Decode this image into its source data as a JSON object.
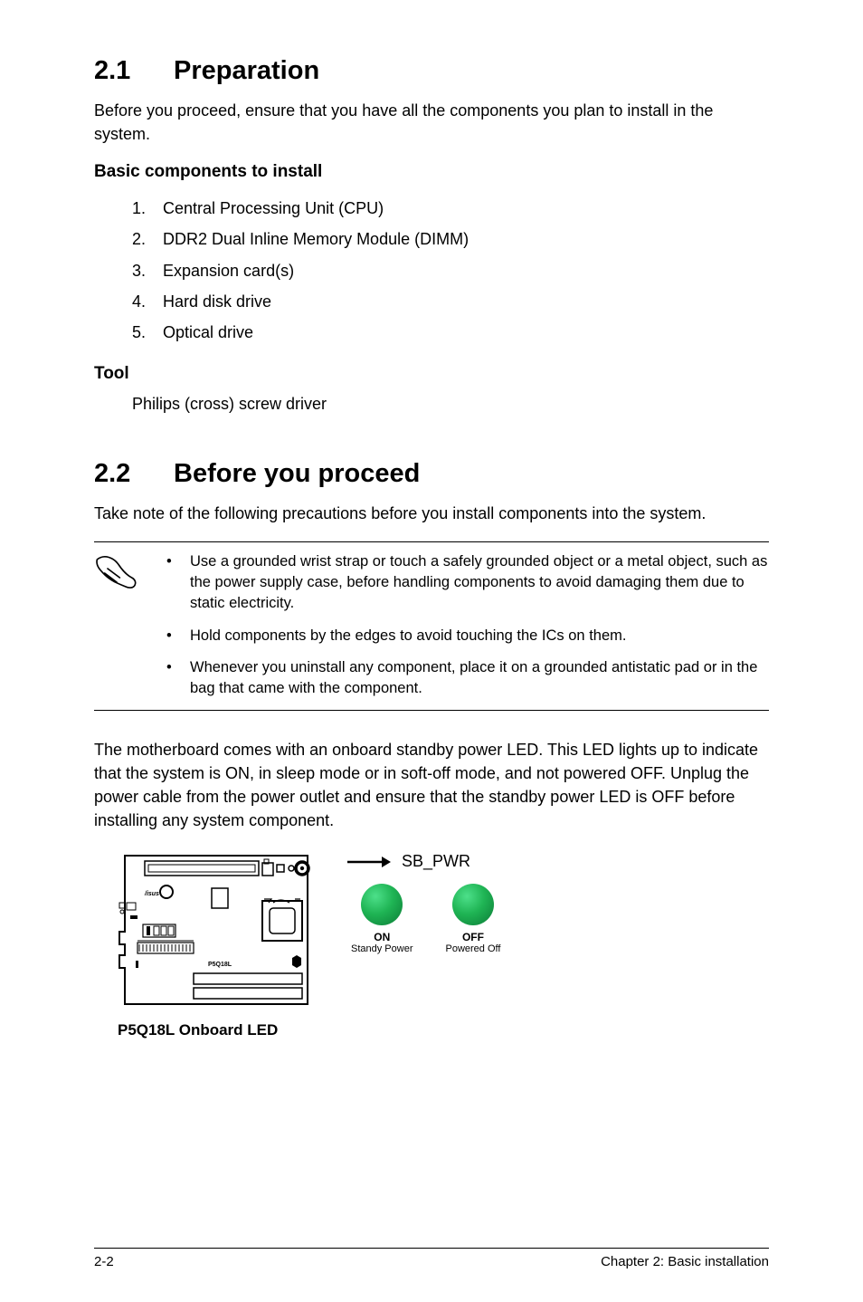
{
  "section1": {
    "number": "2.1",
    "title": "Preparation",
    "intro": "Before you proceed, ensure that you have all the components you plan to install in the system.",
    "basic_heading": "Basic components to install",
    "basic_items": [
      "Central Processing Unit (CPU)",
      "DDR2 Dual Inline Memory Module (DIMM)",
      "Expansion card(s)",
      "Hard disk drive",
      "Optical drive"
    ],
    "tool_heading": "Tool",
    "tool_text": "Philips (cross) screw driver"
  },
  "section2": {
    "number": "2.2",
    "title": "Before you proceed",
    "intro": "Take note of the following precautions before you install components into the system.",
    "notes": [
      "Use a grounded wrist strap or touch a safely grounded object or a metal object, such as the power supply case, before handling components to avoid damaging them due to static electricity.",
      "Hold components by the edges to avoid touching the ICs on them.",
      "Whenever you uninstall any component, place it on a grounded antistatic pad or in the bag that came with the component."
    ],
    "standby_para": "The motherboard comes with an onboard standby power LED. This LED lights up to indicate that the system is ON, in sleep mode or in soft-off mode, and not powered OFF. Unplug the power cable from the power outlet and ensure that the standby power LED is OFF before installing any system component."
  },
  "diagram": {
    "sb_label": "SB_PWR",
    "led_on_title": "ON",
    "led_on_sub": "Standy Power",
    "led_off_title": "OFF",
    "led_off_sub": "Powered Off",
    "caption": "P5Q18L Onboard LED",
    "board_label": "P5Q18L"
  },
  "footer": {
    "left": "2-2",
    "right": "Chapter 2: Basic installation"
  }
}
